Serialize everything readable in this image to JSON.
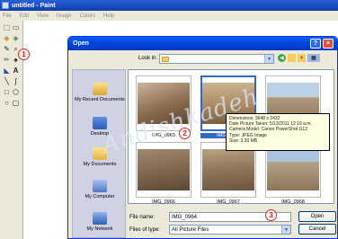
{
  "paint": {
    "title": "untitled - Paint",
    "menu": [
      "File",
      "Edit",
      "View",
      "Image",
      "Colors",
      "Help"
    ]
  },
  "dialog": {
    "title": "Open",
    "help_glyph": "?",
    "close_glyph": "×",
    "lookin_label": "Look in:",
    "places": [
      {
        "label": "My Recent Documents",
        "icon": "recent-documents-icon"
      },
      {
        "label": "Desktop",
        "icon": "desktop-icon"
      },
      {
        "label": "My Documents",
        "icon": "my-documents-icon"
      },
      {
        "label": "My Computer",
        "icon": "my-computer-icon"
      },
      {
        "label": "My Network",
        "icon": "my-network-icon"
      }
    ],
    "files": [
      {
        "name": "IMG_0963"
      },
      {
        "name": "IMG_0964",
        "selected": true
      },
      {
        "name": ""
      },
      {
        "name": "IMG_0966"
      },
      {
        "name": "IMG_0967"
      },
      {
        "name": "IMG_0968"
      }
    ],
    "tooltip": [
      "Dimensions: 3648 x 2432",
      "Date Picture Taken: 5/13/2011 12:19 a.m.",
      "Camera Model: Canon PowerShot G12",
      "Type: JPEG Image",
      "Size: 3.30 MB"
    ],
    "filename_label": "File name:",
    "filename_value": "IMG_0964",
    "filetype_label": "Files of type:",
    "filetype_value": "All Picture Files",
    "open_button": "Open",
    "cancel_button": "Cancel"
  },
  "annotations": [
    "1",
    "2",
    "3"
  ],
  "watermark": "Andishkadeh"
}
